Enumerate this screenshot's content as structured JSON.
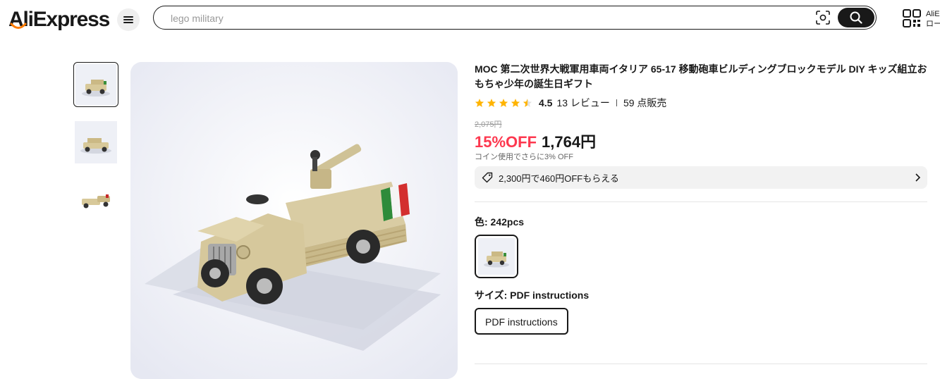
{
  "header": {
    "logo": "AliExpress",
    "search": {
      "value": "",
      "placeholder": "lego military"
    },
    "app_line1": "AliE",
    "app_line2": "ロー"
  },
  "gallery": {
    "thumbnails": [
      "vehicle-thumb-1",
      "vehicle-thumb-2",
      "vehicle-thumb-3"
    ],
    "active_index": 0
  },
  "product": {
    "title": "MOC 第二次世界大戦軍用車両イタリア 65-17 移動砲車ビルディングブロックモデル DIY キッズ組立おもちゃ少年の誕生日ギフト",
    "rating": "4.5",
    "stars": 4.5,
    "reviews": "13 レビュー",
    "sold": "59 点販売",
    "original_price": "2,075円",
    "discount": "15%OFF",
    "price": "1,764円",
    "coin_note": "コイン使用でさらに3% OFF",
    "coupon": "2,300円で460円OFFもらえる",
    "color_label": "色: 242pcs",
    "size_label": "サイズ: PDF instructions",
    "size_option": "PDF instructions"
  },
  "colors": {
    "accent": "#fd384f",
    "star": "#ffb400",
    "text": "#191919"
  }
}
